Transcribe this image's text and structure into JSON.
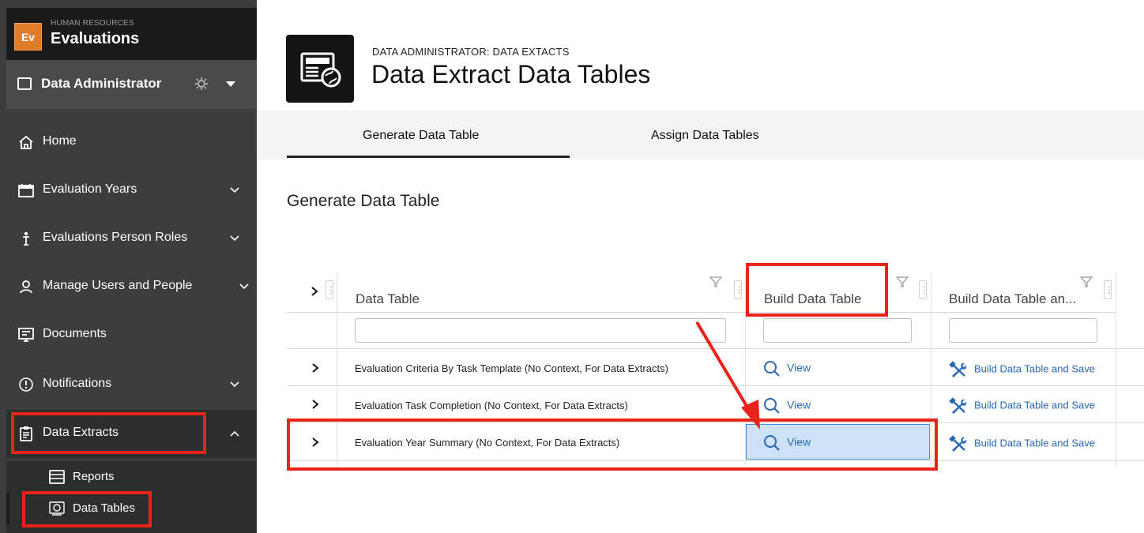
{
  "app": {
    "logo_text": "Ev",
    "subtitle": "HUMAN RESOURCES",
    "title": "Evaluations"
  },
  "role": {
    "label": "Data Administrator"
  },
  "sidebar": {
    "items": [
      {
        "label": "Home",
        "icon": "home-icon"
      },
      {
        "label": "Evaluation Years",
        "icon": "calendar-icon"
      },
      {
        "label": "Evaluations Person Roles",
        "icon": "person-icon"
      },
      {
        "label": "Manage Users and People",
        "icon": "users-icon"
      },
      {
        "label": "Documents",
        "icon": "documents-icon"
      },
      {
        "label": "Notifications",
        "icon": "alert-icon"
      },
      {
        "label": "Data Extracts",
        "icon": "clipboard-icon"
      }
    ],
    "sub_items": [
      {
        "label": "Reports",
        "icon": "reports-icon"
      },
      {
        "label": "Data Tables",
        "icon": "data-tables-icon"
      }
    ]
  },
  "header": {
    "breadcrumb": "DATA ADMINISTRATOR: DATA EXTACTS",
    "title": "Data Extract Data Tables"
  },
  "tabs": [
    {
      "label": "Generate Data Table",
      "active": true
    },
    {
      "label": "Assign Data Tables",
      "active": false
    }
  ],
  "section": {
    "title": "Generate Data Table"
  },
  "grid": {
    "columns": [
      "Data Table",
      "Build Data Table",
      "Build Data Table an..."
    ],
    "rows": [
      {
        "name": "Evaluation Criteria By Task Template (No Context, For Data Extracts)",
        "view": "View",
        "build": "Build Data Table and Save"
      },
      {
        "name": "Evaluation Task Completion (No Context, For Data Extracts)",
        "view": "View",
        "build": "Build Data Table and Save"
      },
      {
        "name": "Evaluation Year Summary (No Context, For Data Extracts)",
        "view": "View",
        "build": "Build Data Table and Save"
      }
    ]
  },
  "colors": {
    "highlight": "#e8231a",
    "link": "#2a68b5",
    "sidebar_bg": "#3d3d3d",
    "selected_bg": "#cde2f7"
  }
}
